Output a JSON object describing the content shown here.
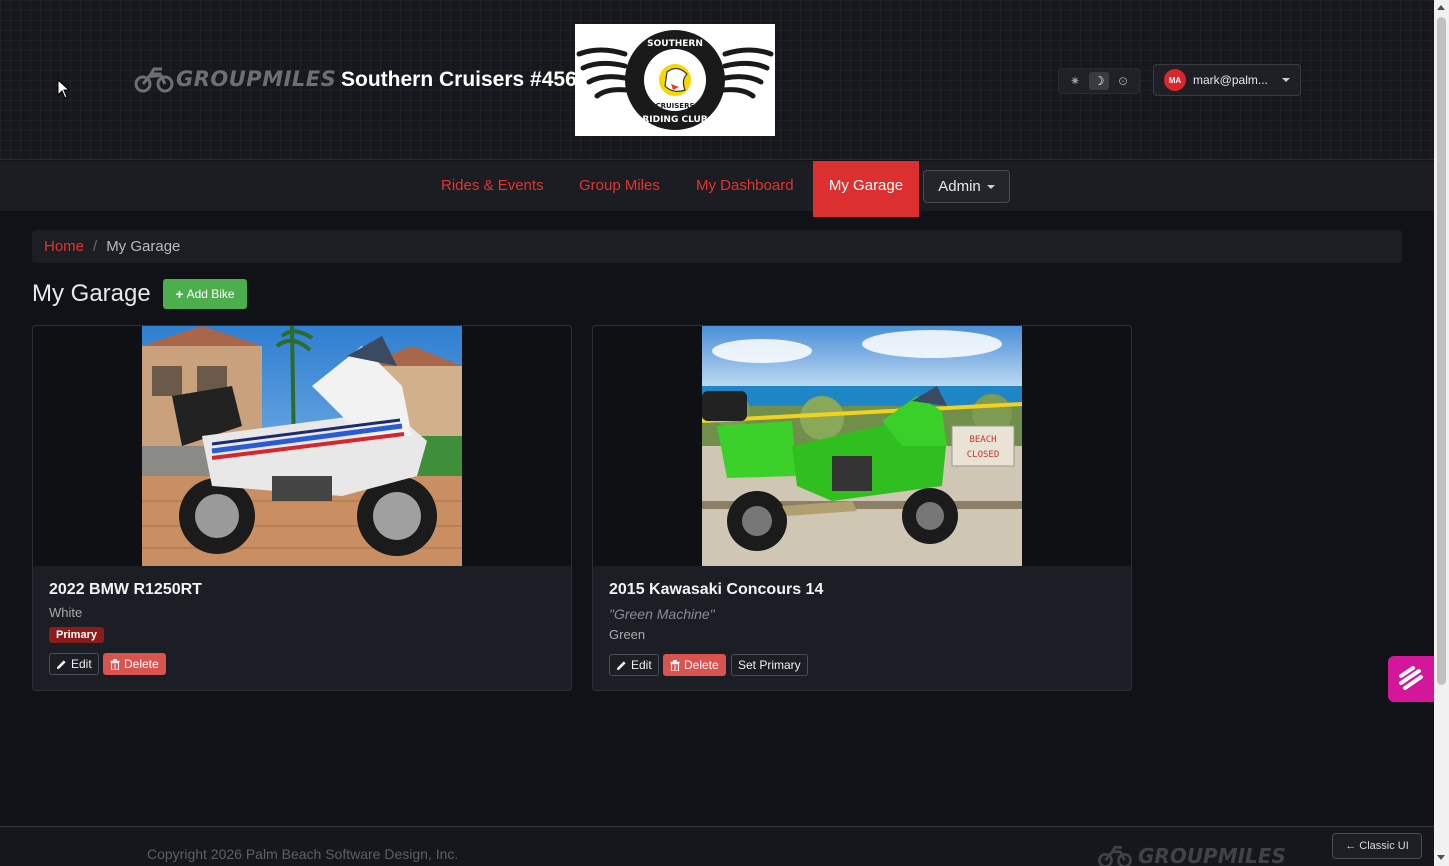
{
  "header": {
    "brand_name": "GROUPMILES",
    "club_title": "Southern Cruisers #456",
    "club_logo": {
      "top_text": "SOUTHERN",
      "mid_text": "CRUISERS",
      "bottom_text": "RIDING CLUB"
    },
    "theme_icons": [
      "sun-icon",
      "moon-icon",
      "auto-icon"
    ],
    "theme_active": "moon",
    "user": {
      "initials": "MA",
      "email": "mark@palm..."
    }
  },
  "nav": {
    "items": [
      {
        "label": "Rides & Events"
      },
      {
        "label": "Group Miles"
      },
      {
        "label": "My Dashboard"
      },
      {
        "label": "My Garage",
        "active": true
      }
    ],
    "admin_label": "Admin"
  },
  "breadcrumb": {
    "home": "Home",
    "separator": "/",
    "current": "My Garage"
  },
  "page": {
    "title": "My Garage",
    "add_bike_label": "Add Bike"
  },
  "bikes": [
    {
      "name": "2022 BMW R1250RT",
      "nickname": "",
      "color": "White",
      "badge": "Primary",
      "edit_label": "Edit",
      "delete_label": "Delete"
    },
    {
      "name": "2015 Kawasaki Concours 14",
      "nickname": "\"Green Machine\"",
      "color": "Green",
      "edit_label": "Edit",
      "delete_label": "Delete",
      "set_primary_label": "Set Primary",
      "sign_line1": "BEACH",
      "sign_line2": "CLOSED"
    }
  ],
  "footer": {
    "copyright": "Copyright 2026 Palm Beach Software Design, Inc.",
    "brand_name": "GROUPMILES",
    "classic_label": "← Classic UI"
  },
  "colors": {
    "accent": "#e2342f",
    "active_nav": "#dc2f2f",
    "success": "#4cae4c",
    "danger": "#d9534f",
    "widget": "#d4169a"
  }
}
